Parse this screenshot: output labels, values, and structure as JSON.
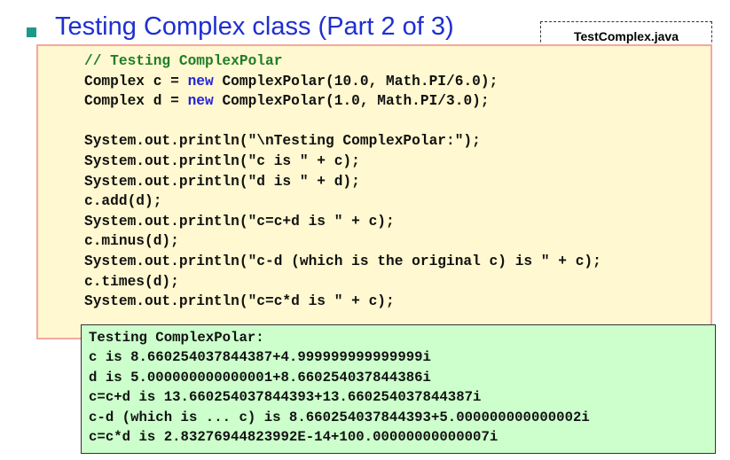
{
  "slide": {
    "title": "Testing Complex class (Part 2 of 3)",
    "file_tag": "TestComplex.java"
  },
  "code": {
    "comment": "// Testing ComplexPolar",
    "line1_pre": "Complex c = ",
    "line1_kw": "new",
    "line1_post": " ComplexPolar(10.0, Math.PI/6.0);",
    "line2_pre": "Complex d = ",
    "line2_kw": "new",
    "line2_post": " ComplexPolar(1.0, Math.PI/3.0);",
    "lines": [
      "System.out.println(\"\\nTesting ComplexPolar:\");",
      "System.out.println(\"c is \" + c);",
      "System.out.println(\"d is \" + d);",
      "c.add(d);",
      "System.out.println(\"c=c+d is \" + c);",
      "c.minus(d);",
      "System.out.println(\"c-d (which is the original c) is \" + c);",
      "c.times(d);",
      "System.out.println(\"c=c*d is \" + c);"
    ]
  },
  "output": {
    "lines": [
      "Testing ComplexPolar:",
      "c is 8.660254037844387+4.999999999999999i",
      "d is 5.000000000000001+8.660254037844386i",
      "c=c+d is 13.660254037844393+13.660254037844387i",
      "c-d (which is ... c) is 8.660254037844393+5.000000000000002i",
      "c=c*d is 2.83276944823992E-14+100.00000000000007i"
    ]
  },
  "colors": {
    "title": "#1f2fd0",
    "bullet": "#1b9a8a",
    "code_background": "#fff8d0",
    "code_border": "#f4a8a0",
    "comment": "#1e7e2a",
    "keyword": "#2424d8",
    "output_background": "#ccffcc"
  }
}
